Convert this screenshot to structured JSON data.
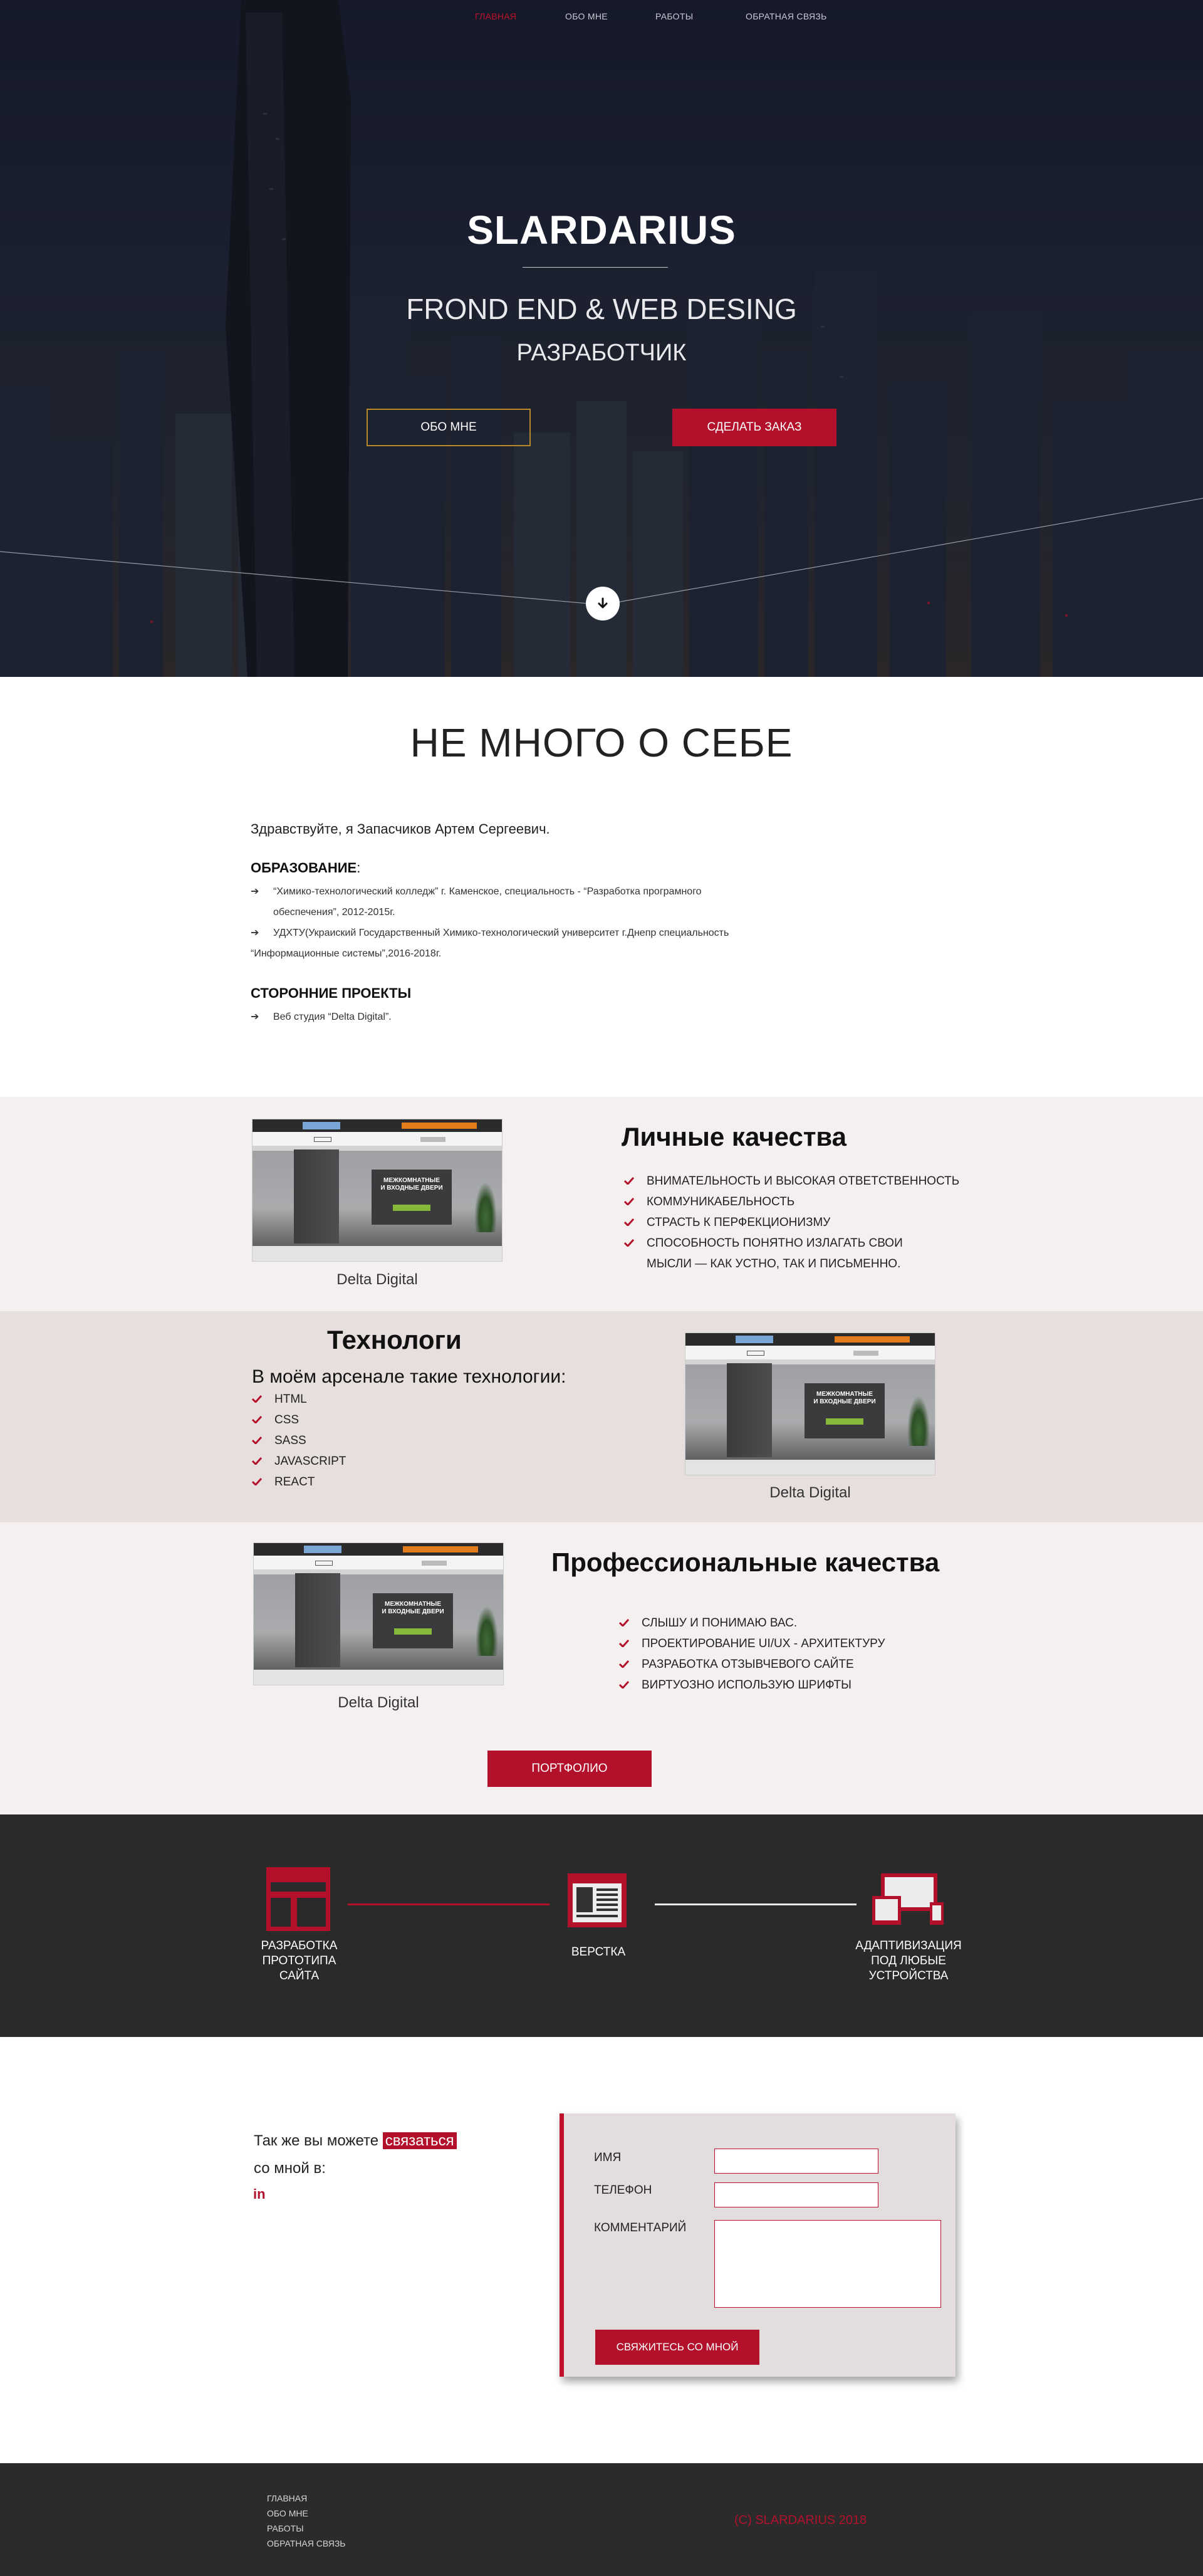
{
  "nav": {
    "items": [
      "ГЛАВНАЯ",
      "ОБО МНЕ",
      "РАБОТЫ",
      "ОБРАТНАЯ СВЯЗЬ"
    ]
  },
  "hero": {
    "title": "SLARDARIUS",
    "subtitle": "FROND END & WEB DESING",
    "subtitle2": "РАЗРАБОТЧИК",
    "about_button": "ОБО МНЕ",
    "order_button": "СДЕЛАТЬ ЗАКАЗ"
  },
  "about": {
    "title": "НЕ МНОГО О СЕБЕ",
    "greeting": "Здравствуйте, я Запасчиков Артем Сергеевич.",
    "education_heading": "ОБРАЗОВАНИЕ",
    "education_colon": ":",
    "education": [
      {
        "line1": "“Химико-технологический колледж” г. Каменское, специальность - “Разработка програмного",
        "line2": "обеспечения”, 2012-2015г."
      },
      {
        "line1": "УДХТУ(Украиский Государственный Химико-технологический университет г.Днепр специальность",
        "line2": "“Информационные системы”,2016-2018г."
      }
    ],
    "projects_heading": "СТОРОННИЕ ПРОЕКТЫ",
    "projects": [
      "Веб студия “Delta Digital”."
    ]
  },
  "screenshot": {
    "panel_line1": "МЕЖКОМНАТНЫЕ",
    "panel_line2": "И ВХОДНЫЕ ДВЕРИ"
  },
  "personal": {
    "title": "Личные качества",
    "caption": "Delta Digital",
    "items": [
      "ВНИМАТЕЛЬНОСТЬ И ВЫСОКАЯ ОТВЕТСТВЕННОСТЬ",
      "КОММУНИКАБЕЛЬНОСТЬ",
      "СТРАСТЬ К ПЕРФЕКЦИОНИЗМУ",
      "СПОСОБНОСТЬ ПОНЯТНО ИЗЛАГАТЬ СВОИ",
      "МЫСЛИ —  КАК УСТНО, ТАК И ПИСЬМЕННО."
    ]
  },
  "tech": {
    "title": "Технологи",
    "intro": "В моём арсенале такие технологии:",
    "caption": "Delta Digital",
    "items": [
      "HTML",
      "CSS",
      "SASS",
      "JAVASCRIPT",
      "REACT"
    ]
  },
  "pro": {
    "title": "Профессиональные качества",
    "caption": "Delta Digital",
    "items": [
      "СЛЫШУ И ПОНИМАЮ ВАС.",
      "ПРОЕКТИРОВАНИЕ UI/UX - АРХИТЕКТУРУ",
      "РАЗРАБОТКА ОТЗЫВЧЕВОГО САЙТЕ",
      "ВИРТУОЗНО ИСПОЛЬЗУЮ ШРИФТЫ"
    ],
    "portfolio_button": "ПОРТФОЛИО"
  },
  "process": {
    "step1": [
      "РАЗРАБОТКА",
      "ПРОТОТИПА",
      "САЙТА"
    ],
    "step2": [
      "ВЕРСТКА"
    ],
    "step3": [
      "АДАПТИВИЗАЦИЯ",
      "ПОД ЛЮБЫЕ",
      "УСТРОЙСТВА"
    ]
  },
  "contact": {
    "text_before": "Так же вы можете ",
    "text_highlight": "связаться",
    "text_line2": "со мной в:",
    "social": "in",
    "form": {
      "name_label": "ИМЯ",
      "phone_label": "ТЕЛЕФОН",
      "comment_label": "КОММЕНТАРИЙ",
      "submit": "СВЯЖИТЕСЬ СО МНОЙ"
    }
  },
  "footer": {
    "links": [
      "ГЛАВНАЯ",
      "ОБО МНЕ",
      "РАБОТЫ",
      "ОБРАТНАЯ СВЯЗЬ"
    ],
    "copyright": "(C) SLARDARIUS 2018"
  },
  "colors": {
    "accent": "#b3112b",
    "dark": "#2a2a2b",
    "band_light": "#f4f0ef",
    "band_mid": "#e6dfde"
  }
}
